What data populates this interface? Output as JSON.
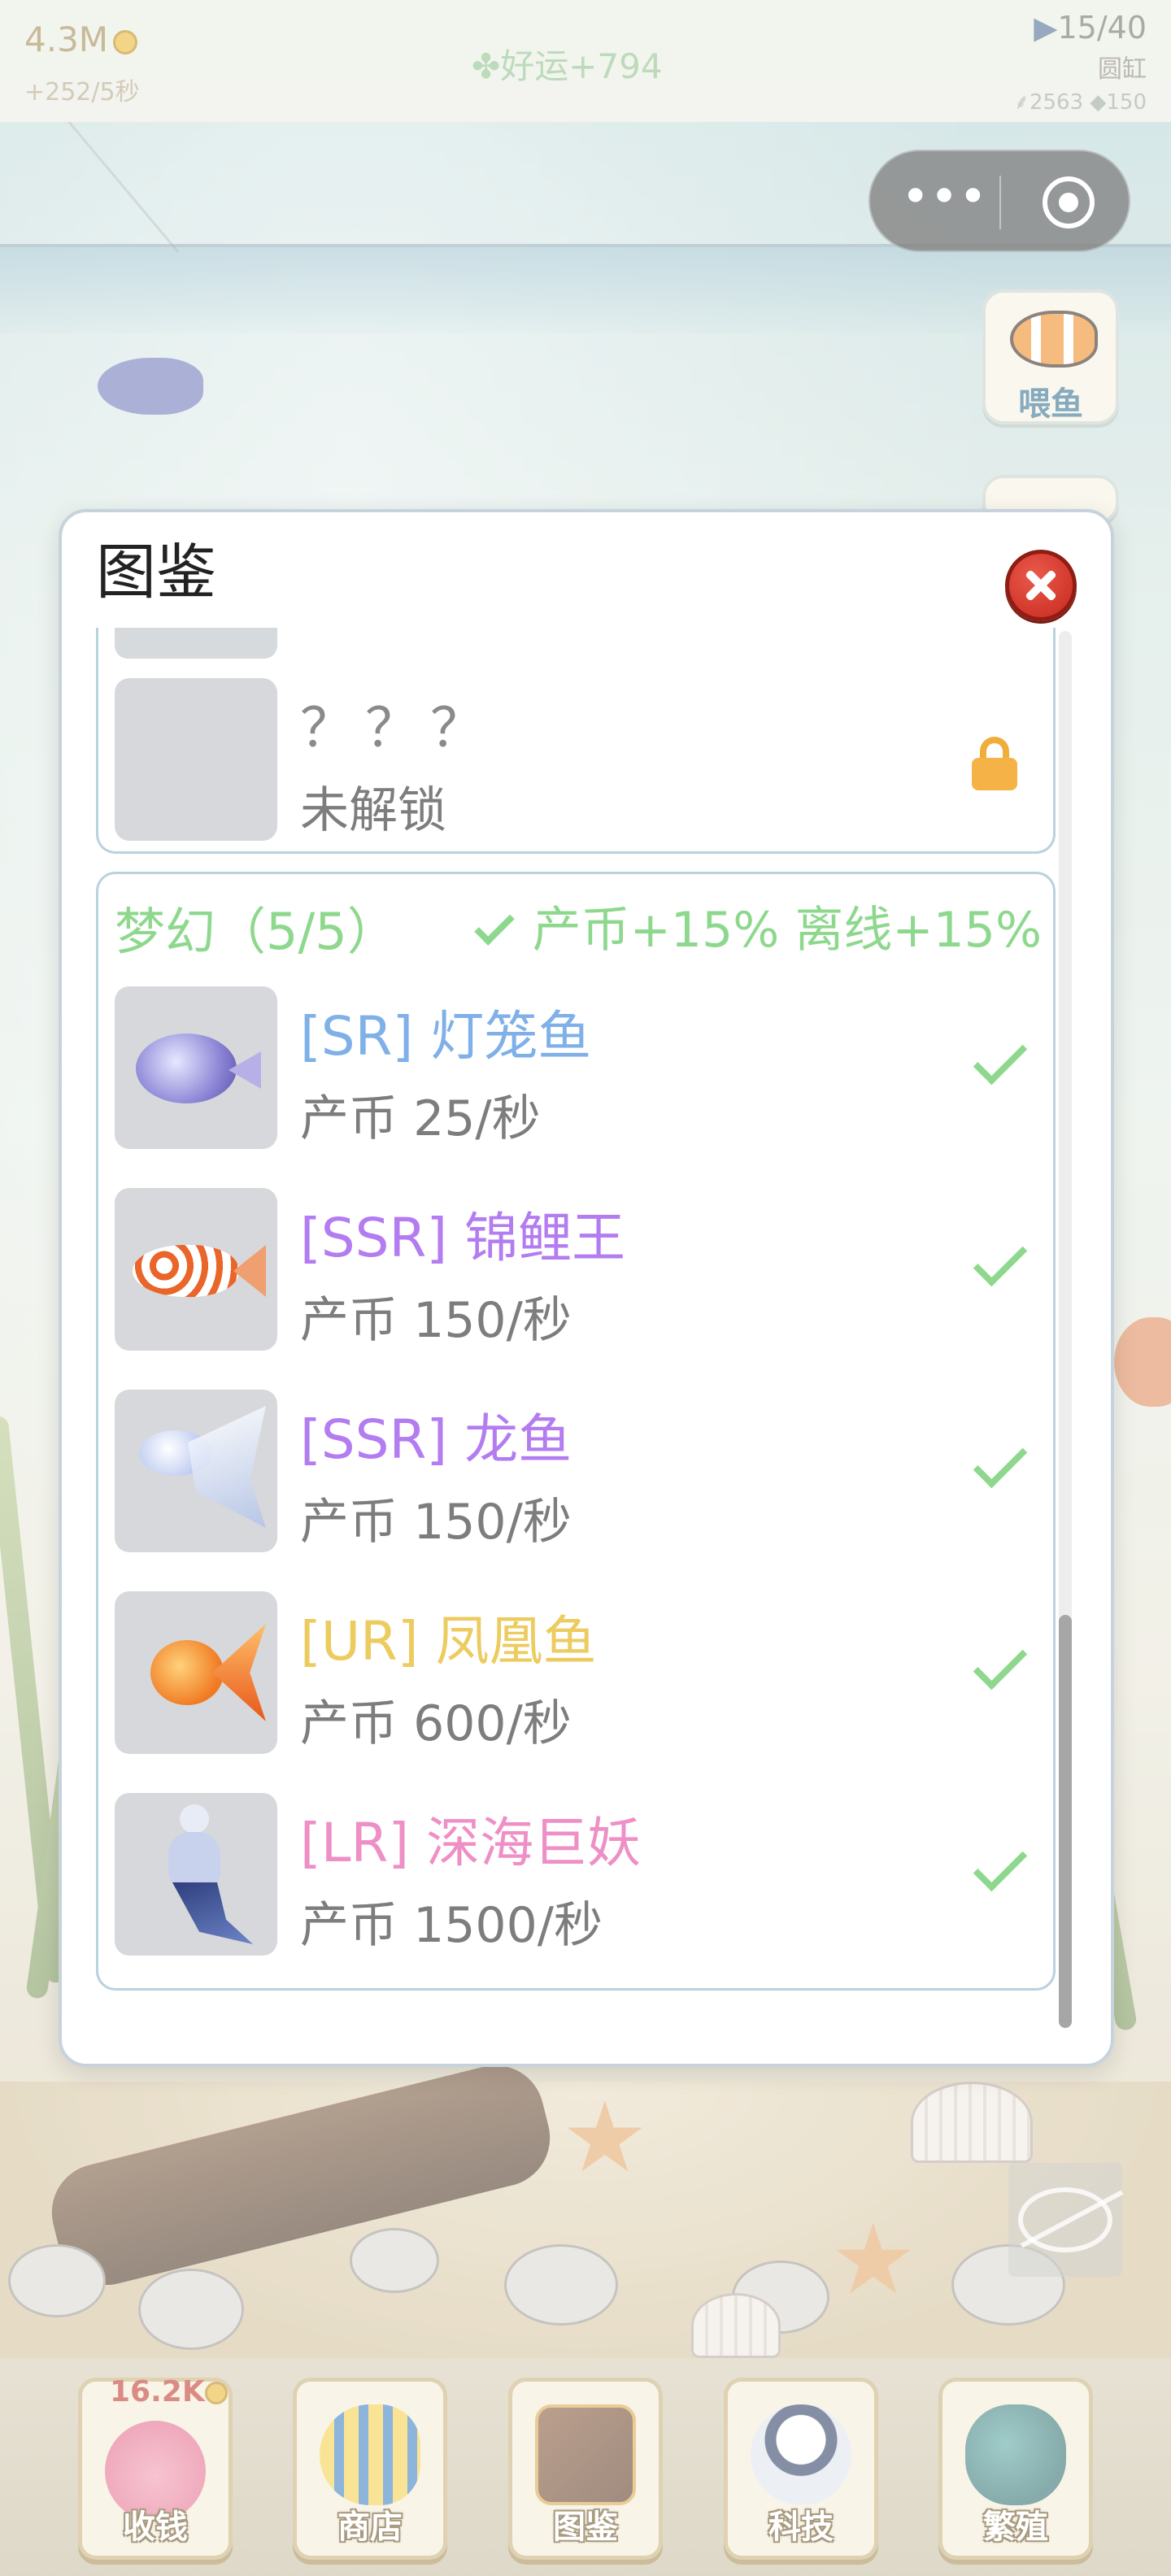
{
  "hud": {
    "coins": "4.3M",
    "rate": "+252/5秒",
    "luck": "✤好运+794",
    "capacity": "15/40",
    "tank": "圆缸",
    "resources": "⸙2563 ◆150"
  },
  "capsule": {
    "more_icon": "more-dots-icon",
    "close_icon": "target-icon"
  },
  "side_buttons": {
    "feed_label": "喂鱼"
  },
  "modal": {
    "title": "图鉴",
    "locked_entry": {
      "name": "？？？",
      "status": "未解锁"
    },
    "category": {
      "name": "梦幻（5/5）",
      "bonus": "产币+15% 离线+15%",
      "complete": true
    },
    "fish": [
      {
        "name": "[SR] 灯笼鱼",
        "income": "产币 25/秒",
        "rarity_color": "#7fb0e8",
        "unlocked": true
      },
      {
        "name": "[SSR] 锦鲤王",
        "income": "产币 150/秒",
        "rarity_color": "#b37cf0",
        "unlocked": true
      },
      {
        "name": "[SSR] 龙鱼",
        "income": "产币 150/秒",
        "rarity_color": "#b37cf0",
        "unlocked": true
      },
      {
        "name": "[UR] 凤凰鱼",
        "income": "产币 600/秒",
        "rarity_color": "#eccb5f",
        "unlocked": true
      },
      {
        "name": "[LR] 深海巨妖",
        "income": "产币 1500/秒",
        "rarity_color": "#ee8fc6",
        "unlocked": true
      }
    ]
  },
  "bottom_nav": {
    "badge": "16.2K",
    "items": [
      {
        "label": "收钱",
        "icon": "piggy-bank-icon"
      },
      {
        "label": "商店",
        "icon": "shop-fish-icon"
      },
      {
        "label": "图鉴",
        "icon": "book-icon"
      },
      {
        "label": "科技",
        "icon": "astronaut-icon"
      },
      {
        "label": "繁殖",
        "icon": "breeding-icon"
      }
    ]
  },
  "colors": {
    "check_green": "#8ed88e",
    "close_red": "#d63a2c",
    "lock_orange": "#f5b347",
    "card_border": "#b8d3dd"
  }
}
